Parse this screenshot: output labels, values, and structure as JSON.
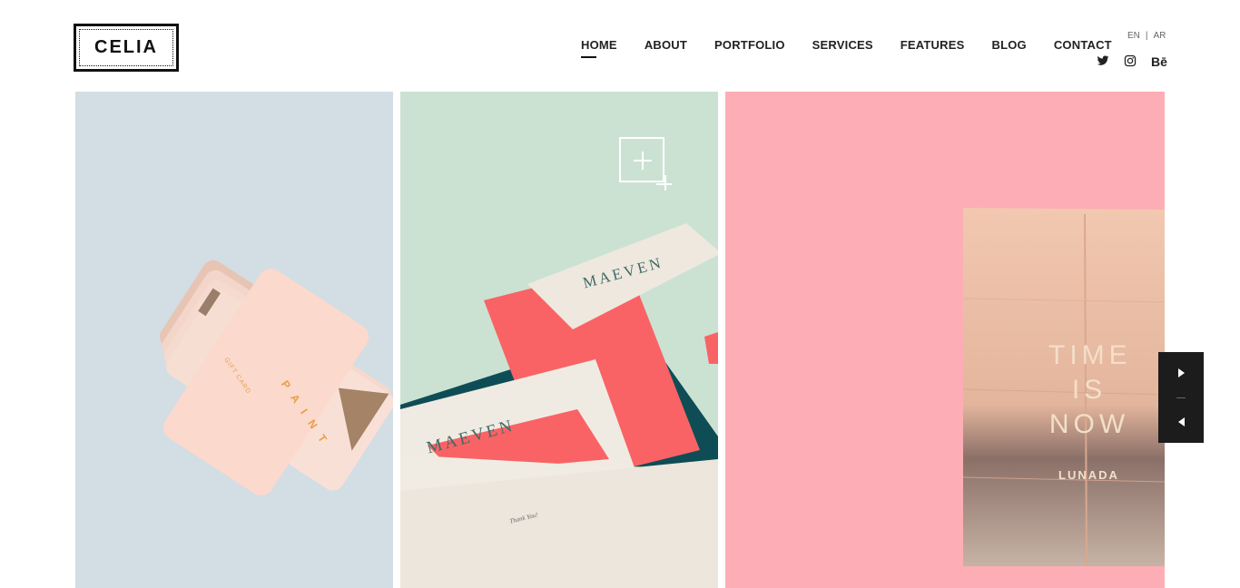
{
  "brand": {
    "logo": "CELIA"
  },
  "nav": {
    "items": [
      {
        "label": "HOME",
        "active": true
      },
      {
        "label": "ABOUT"
      },
      {
        "label": "PORTFOLIO"
      },
      {
        "label": "SERVICES"
      },
      {
        "label": "FEATURES"
      },
      {
        "label": "BLOG"
      },
      {
        "label": "CONTACT"
      }
    ]
  },
  "lang": {
    "en": "EN",
    "sep": "|",
    "ar": "AR"
  },
  "social": {
    "twitter_icon": "twitter-icon",
    "instagram_icon": "instagram-icon",
    "behance": "Bē"
  },
  "portfolio": {
    "items": [
      {
        "bg": "#d3dde4",
        "card_text": "GIFT CARD",
        "brand_text": "PAINT"
      },
      {
        "bg": "#cbe2d3",
        "brand_text": "MAEVEN",
        "thankyou": "Thank You!"
      },
      {
        "bg": "#fdadb5",
        "poster_lines": [
          "TIME",
          "IS",
          "NOW"
        ],
        "poster_brand": "LUNADA"
      }
    ]
  },
  "colors": {
    "accent_dark": "#1c1c1c",
    "coral": "#f96365",
    "teal": "#0e4d55"
  }
}
